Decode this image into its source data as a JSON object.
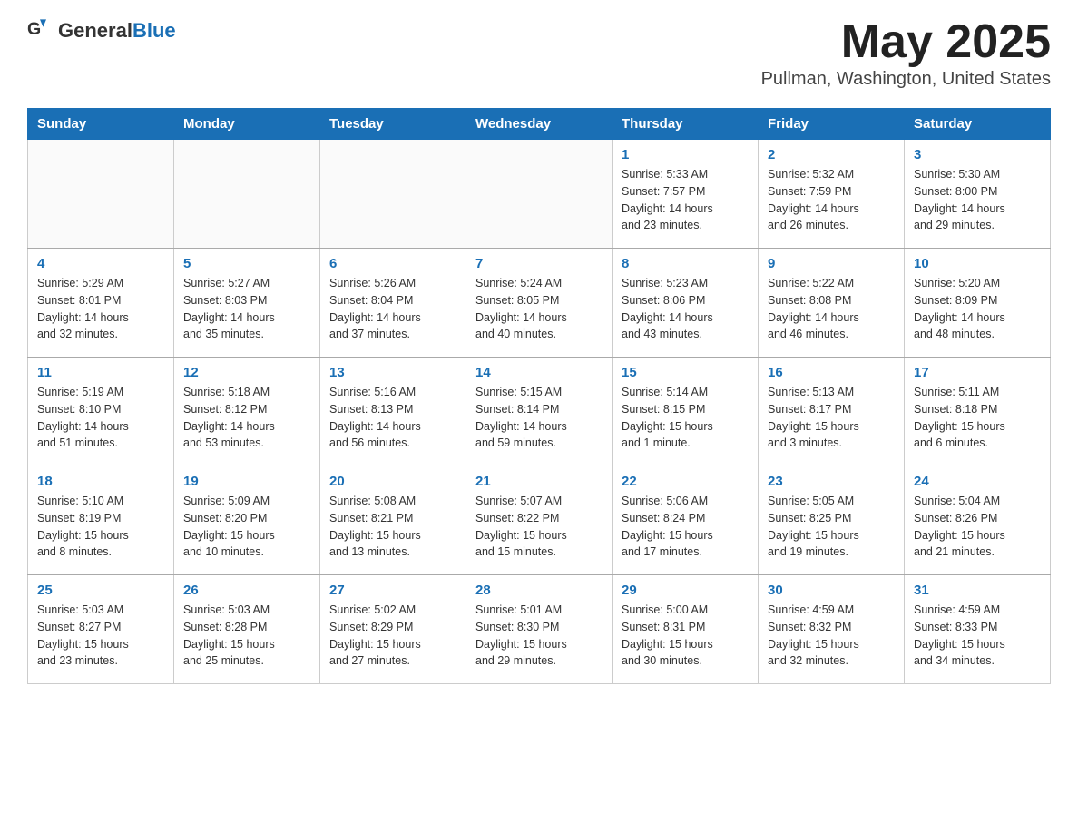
{
  "header": {
    "logo_general": "General",
    "logo_blue": "Blue",
    "title": "May 2025",
    "subtitle": "Pullman, Washington, United States"
  },
  "days_of_week": [
    "Sunday",
    "Monday",
    "Tuesday",
    "Wednesday",
    "Thursday",
    "Friday",
    "Saturday"
  ],
  "weeks": [
    [
      {
        "day": "",
        "info": ""
      },
      {
        "day": "",
        "info": ""
      },
      {
        "day": "",
        "info": ""
      },
      {
        "day": "",
        "info": ""
      },
      {
        "day": "1",
        "info": "Sunrise: 5:33 AM\nSunset: 7:57 PM\nDaylight: 14 hours\nand 23 minutes."
      },
      {
        "day": "2",
        "info": "Sunrise: 5:32 AM\nSunset: 7:59 PM\nDaylight: 14 hours\nand 26 minutes."
      },
      {
        "day": "3",
        "info": "Sunrise: 5:30 AM\nSunset: 8:00 PM\nDaylight: 14 hours\nand 29 minutes."
      }
    ],
    [
      {
        "day": "4",
        "info": "Sunrise: 5:29 AM\nSunset: 8:01 PM\nDaylight: 14 hours\nand 32 minutes."
      },
      {
        "day": "5",
        "info": "Sunrise: 5:27 AM\nSunset: 8:03 PM\nDaylight: 14 hours\nand 35 minutes."
      },
      {
        "day": "6",
        "info": "Sunrise: 5:26 AM\nSunset: 8:04 PM\nDaylight: 14 hours\nand 37 minutes."
      },
      {
        "day": "7",
        "info": "Sunrise: 5:24 AM\nSunset: 8:05 PM\nDaylight: 14 hours\nand 40 minutes."
      },
      {
        "day": "8",
        "info": "Sunrise: 5:23 AM\nSunset: 8:06 PM\nDaylight: 14 hours\nand 43 minutes."
      },
      {
        "day": "9",
        "info": "Sunrise: 5:22 AM\nSunset: 8:08 PM\nDaylight: 14 hours\nand 46 minutes."
      },
      {
        "day": "10",
        "info": "Sunrise: 5:20 AM\nSunset: 8:09 PM\nDaylight: 14 hours\nand 48 minutes."
      }
    ],
    [
      {
        "day": "11",
        "info": "Sunrise: 5:19 AM\nSunset: 8:10 PM\nDaylight: 14 hours\nand 51 minutes."
      },
      {
        "day": "12",
        "info": "Sunrise: 5:18 AM\nSunset: 8:12 PM\nDaylight: 14 hours\nand 53 minutes."
      },
      {
        "day": "13",
        "info": "Sunrise: 5:16 AM\nSunset: 8:13 PM\nDaylight: 14 hours\nand 56 minutes."
      },
      {
        "day": "14",
        "info": "Sunrise: 5:15 AM\nSunset: 8:14 PM\nDaylight: 14 hours\nand 59 minutes."
      },
      {
        "day": "15",
        "info": "Sunrise: 5:14 AM\nSunset: 8:15 PM\nDaylight: 15 hours\nand 1 minute."
      },
      {
        "day": "16",
        "info": "Sunrise: 5:13 AM\nSunset: 8:17 PM\nDaylight: 15 hours\nand 3 minutes."
      },
      {
        "day": "17",
        "info": "Sunrise: 5:11 AM\nSunset: 8:18 PM\nDaylight: 15 hours\nand 6 minutes."
      }
    ],
    [
      {
        "day": "18",
        "info": "Sunrise: 5:10 AM\nSunset: 8:19 PM\nDaylight: 15 hours\nand 8 minutes."
      },
      {
        "day": "19",
        "info": "Sunrise: 5:09 AM\nSunset: 8:20 PM\nDaylight: 15 hours\nand 10 minutes."
      },
      {
        "day": "20",
        "info": "Sunrise: 5:08 AM\nSunset: 8:21 PM\nDaylight: 15 hours\nand 13 minutes."
      },
      {
        "day": "21",
        "info": "Sunrise: 5:07 AM\nSunset: 8:22 PM\nDaylight: 15 hours\nand 15 minutes."
      },
      {
        "day": "22",
        "info": "Sunrise: 5:06 AM\nSunset: 8:24 PM\nDaylight: 15 hours\nand 17 minutes."
      },
      {
        "day": "23",
        "info": "Sunrise: 5:05 AM\nSunset: 8:25 PM\nDaylight: 15 hours\nand 19 minutes."
      },
      {
        "day": "24",
        "info": "Sunrise: 5:04 AM\nSunset: 8:26 PM\nDaylight: 15 hours\nand 21 minutes."
      }
    ],
    [
      {
        "day": "25",
        "info": "Sunrise: 5:03 AM\nSunset: 8:27 PM\nDaylight: 15 hours\nand 23 minutes."
      },
      {
        "day": "26",
        "info": "Sunrise: 5:03 AM\nSunset: 8:28 PM\nDaylight: 15 hours\nand 25 minutes."
      },
      {
        "day": "27",
        "info": "Sunrise: 5:02 AM\nSunset: 8:29 PM\nDaylight: 15 hours\nand 27 minutes."
      },
      {
        "day": "28",
        "info": "Sunrise: 5:01 AM\nSunset: 8:30 PM\nDaylight: 15 hours\nand 29 minutes."
      },
      {
        "day": "29",
        "info": "Sunrise: 5:00 AM\nSunset: 8:31 PM\nDaylight: 15 hours\nand 30 minutes."
      },
      {
        "day": "30",
        "info": "Sunrise: 4:59 AM\nSunset: 8:32 PM\nDaylight: 15 hours\nand 32 minutes."
      },
      {
        "day": "31",
        "info": "Sunrise: 4:59 AM\nSunset: 8:33 PM\nDaylight: 15 hours\nand 34 minutes."
      }
    ]
  ]
}
